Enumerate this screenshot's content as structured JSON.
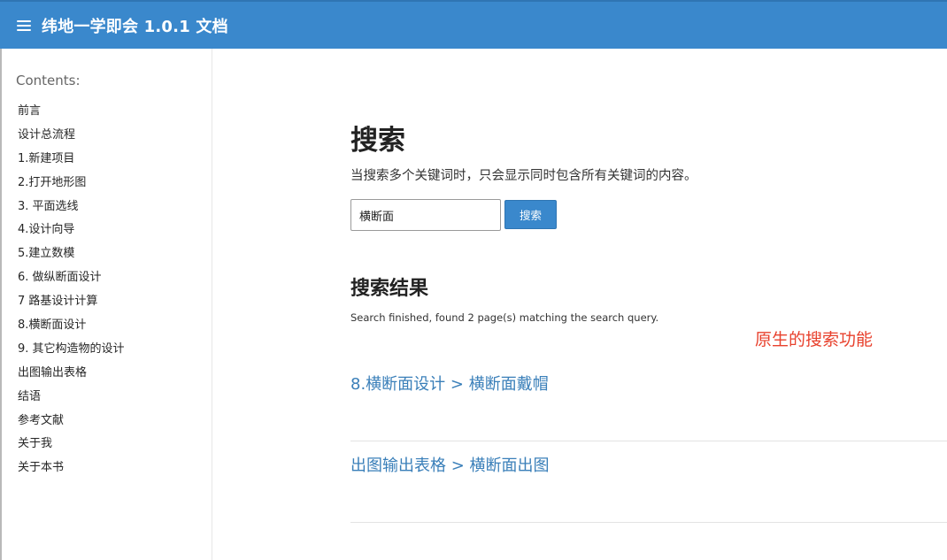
{
  "header": {
    "menu_icon": "hamburger-menu-icon",
    "brand": "纬地一学即会 1.0.1 文档"
  },
  "sidebar": {
    "caption": "Contents:",
    "items": [
      {
        "label": "前言"
      },
      {
        "label": "设计总流程"
      },
      {
        "label": "1.新建项目"
      },
      {
        "label": "2.打开地形图"
      },
      {
        "label": "3. 平面选线"
      },
      {
        "label": "4.设计向导"
      },
      {
        "label": "5.建立数模"
      },
      {
        "label": "6. 做纵断面设计"
      },
      {
        "label": "7 路基设计计算"
      },
      {
        "label": "8.横断面设计"
      },
      {
        "label": "9. 其它构造物的设计"
      },
      {
        "label": "出图输出表格"
      },
      {
        "label": "结语"
      },
      {
        "label": "参考文献"
      },
      {
        "label": "关于我"
      },
      {
        "label": "关于本书"
      }
    ]
  },
  "main": {
    "title": "搜索",
    "hint": "当搜索多个关键词时，只会显示同时包含所有关键词的内容。",
    "search": {
      "value": "横断面",
      "button_label": "搜索"
    },
    "results_title": "搜索结果",
    "summary": "Search finished, found 2 page(s) matching the search query.",
    "annotation": "原生的搜索功能",
    "results": [
      {
        "label": "8.横断面设计 > 横断面戴帽"
      },
      {
        "label": "出图输出表格 > 横断面出图"
      }
    ]
  },
  "colors": {
    "header_bg": "#3a88cc",
    "link": "#3a7fb9",
    "annotation": "#e8412d"
  }
}
